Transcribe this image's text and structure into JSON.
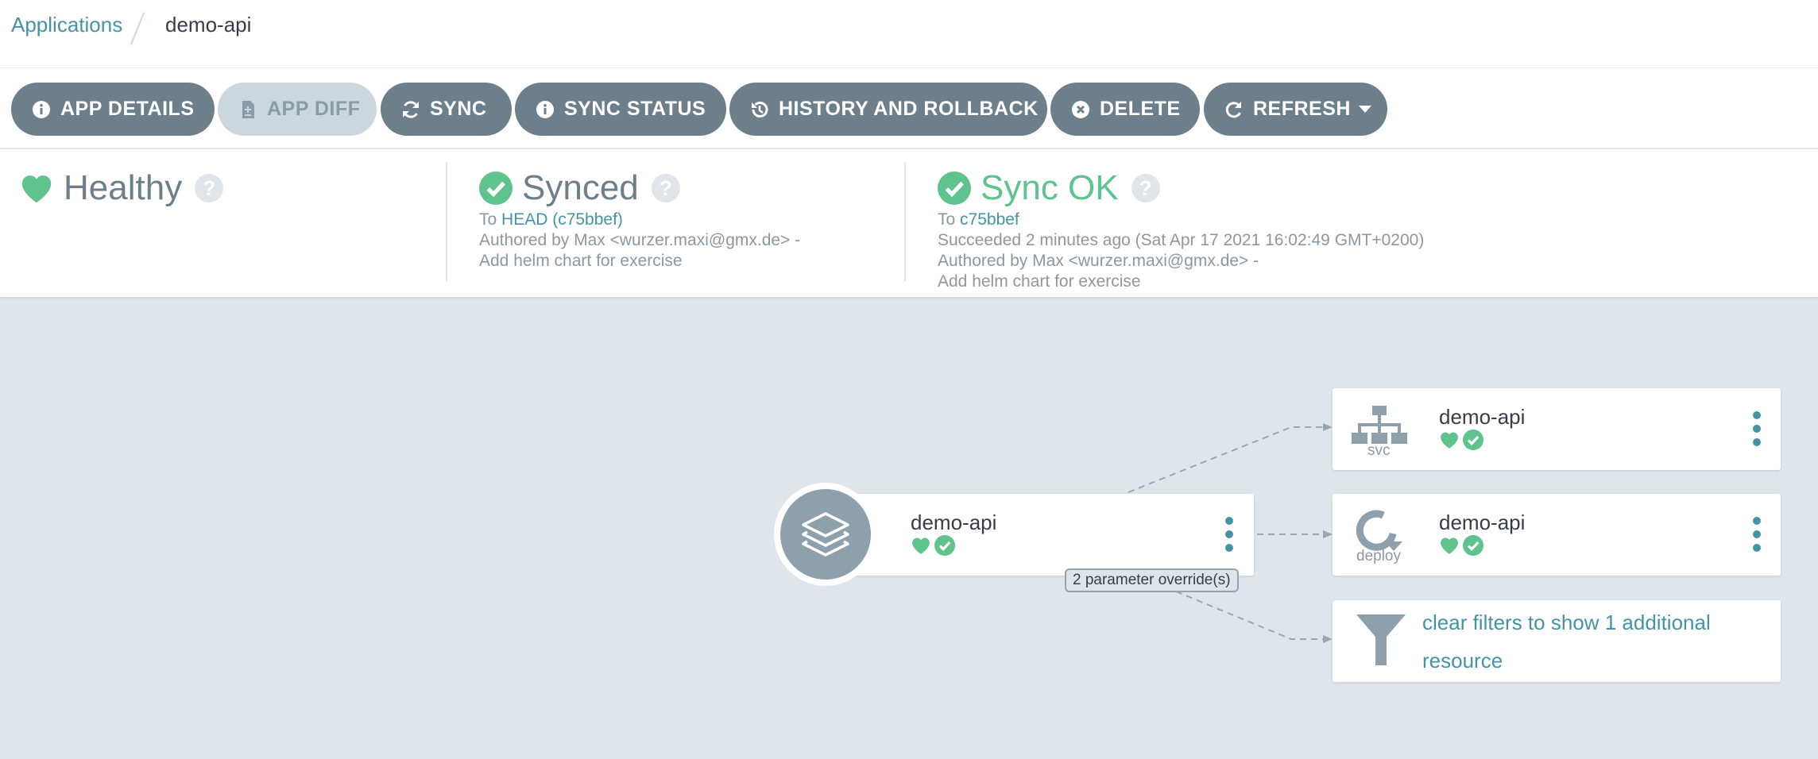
{
  "breadcrumb": {
    "root": "Applications",
    "current": "demo-api"
  },
  "toolbar": {
    "buttons": [
      {
        "label": "APP DETAILS",
        "icon": "info-icon"
      },
      {
        "label": "APP DIFF",
        "icon": "file-diff-icon",
        "disabled": true
      },
      {
        "label": "SYNC",
        "icon": "sync-icon"
      },
      {
        "label": "SYNC STATUS",
        "icon": "info-icon"
      },
      {
        "label": "HISTORY AND ROLLBACK",
        "icon": "history-icon"
      },
      {
        "label": "DELETE",
        "icon": "times-circle-icon"
      },
      {
        "label": "REFRESH",
        "icon": "redo-icon",
        "dropdown": true
      }
    ]
  },
  "status": {
    "health": {
      "title": "Healthy",
      "icon": "heart-icon",
      "help": "?"
    },
    "sync": {
      "title": "Synced",
      "icon": "check-circle-icon",
      "help": "?",
      "to_prefix": "To",
      "revision": "HEAD (c75bbef)",
      "author": "Authored by Max <wurzer.maxi@gmx.de> -",
      "message": "Add helm chart for exercise"
    },
    "operation": {
      "title": "Sync OK",
      "icon": "check-circle-icon",
      "help": "?",
      "to_prefix": "To",
      "revision": "c75bbef",
      "succeeded": "Succeeded 2 minutes ago (Sat Apr 17 2021 16:02:49 GMT+0200)",
      "author": "Authored by Max <wurzer.maxi@gmx.de> -",
      "message": "Add helm chart for exercise"
    }
  },
  "graph": {
    "app": {
      "name": "demo-api",
      "icon": "layers-icon",
      "badge": "2 parameter override(s)"
    },
    "resources": [
      {
        "name": "demo-api",
        "kind": "svc",
        "icon": "sitemap-icon"
      },
      {
        "name": "demo-api",
        "kind": "deploy",
        "icon": "rotate-icon"
      }
    ],
    "filter": {
      "text": "clear filters to show 1 additional resource",
      "icon": "filter-icon"
    }
  },
  "colors": {
    "accent": "#4593a6",
    "healthy": "#5ec38c",
    "button": "#6d7f8b",
    "background": "#dee6eb"
  }
}
